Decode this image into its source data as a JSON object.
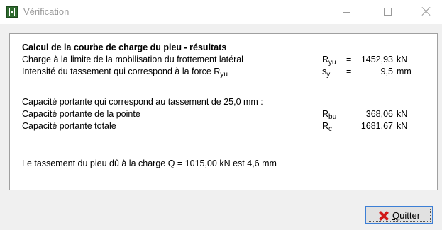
{
  "window": {
    "title": "Vérification",
    "app_icon": "app-icon",
    "controls": {
      "minimize": "minimize-icon",
      "maximize": "maximize-icon",
      "close": "close-icon"
    }
  },
  "results": {
    "heading": "Calcul de la courbe de charge du pieu - résultats",
    "lines": [
      {
        "label": "Charge à la limite de la mobilisation du frottement latéral",
        "symbol": "R",
        "symbol_sub": "yu",
        "eq": "=",
        "value": "1452,93",
        "unit": "kN"
      },
      {
        "label": "Intensité du tassement qui correspond à la force R",
        "label_sub": "yu",
        "symbol": "s",
        "symbol_sub": "y",
        "eq": "=",
        "value": "9,5",
        "unit": "mm"
      }
    ],
    "capacity_intro": "Capacité portante qui correspond au tassement de 25,0 mm :",
    "capacities": [
      {
        "label": "Capacité portante de la pointe",
        "symbol": "R",
        "symbol_sub": "bu",
        "eq": "=",
        "value": "368,06",
        "unit": "kN"
      },
      {
        "label": "Capacité portante totale",
        "symbol": "R",
        "symbol_sub": "c",
        "eq": "=",
        "value": "1681,67",
        "unit": "kN"
      }
    ],
    "settlement": "Le tassement du pieu dû à la charge Q = 1015,00 kN est 4,6 mm"
  },
  "footer": {
    "quit_label_first": "Q",
    "quit_label_rest": "uitter",
    "quit_icon": "red-x-icon"
  }
}
